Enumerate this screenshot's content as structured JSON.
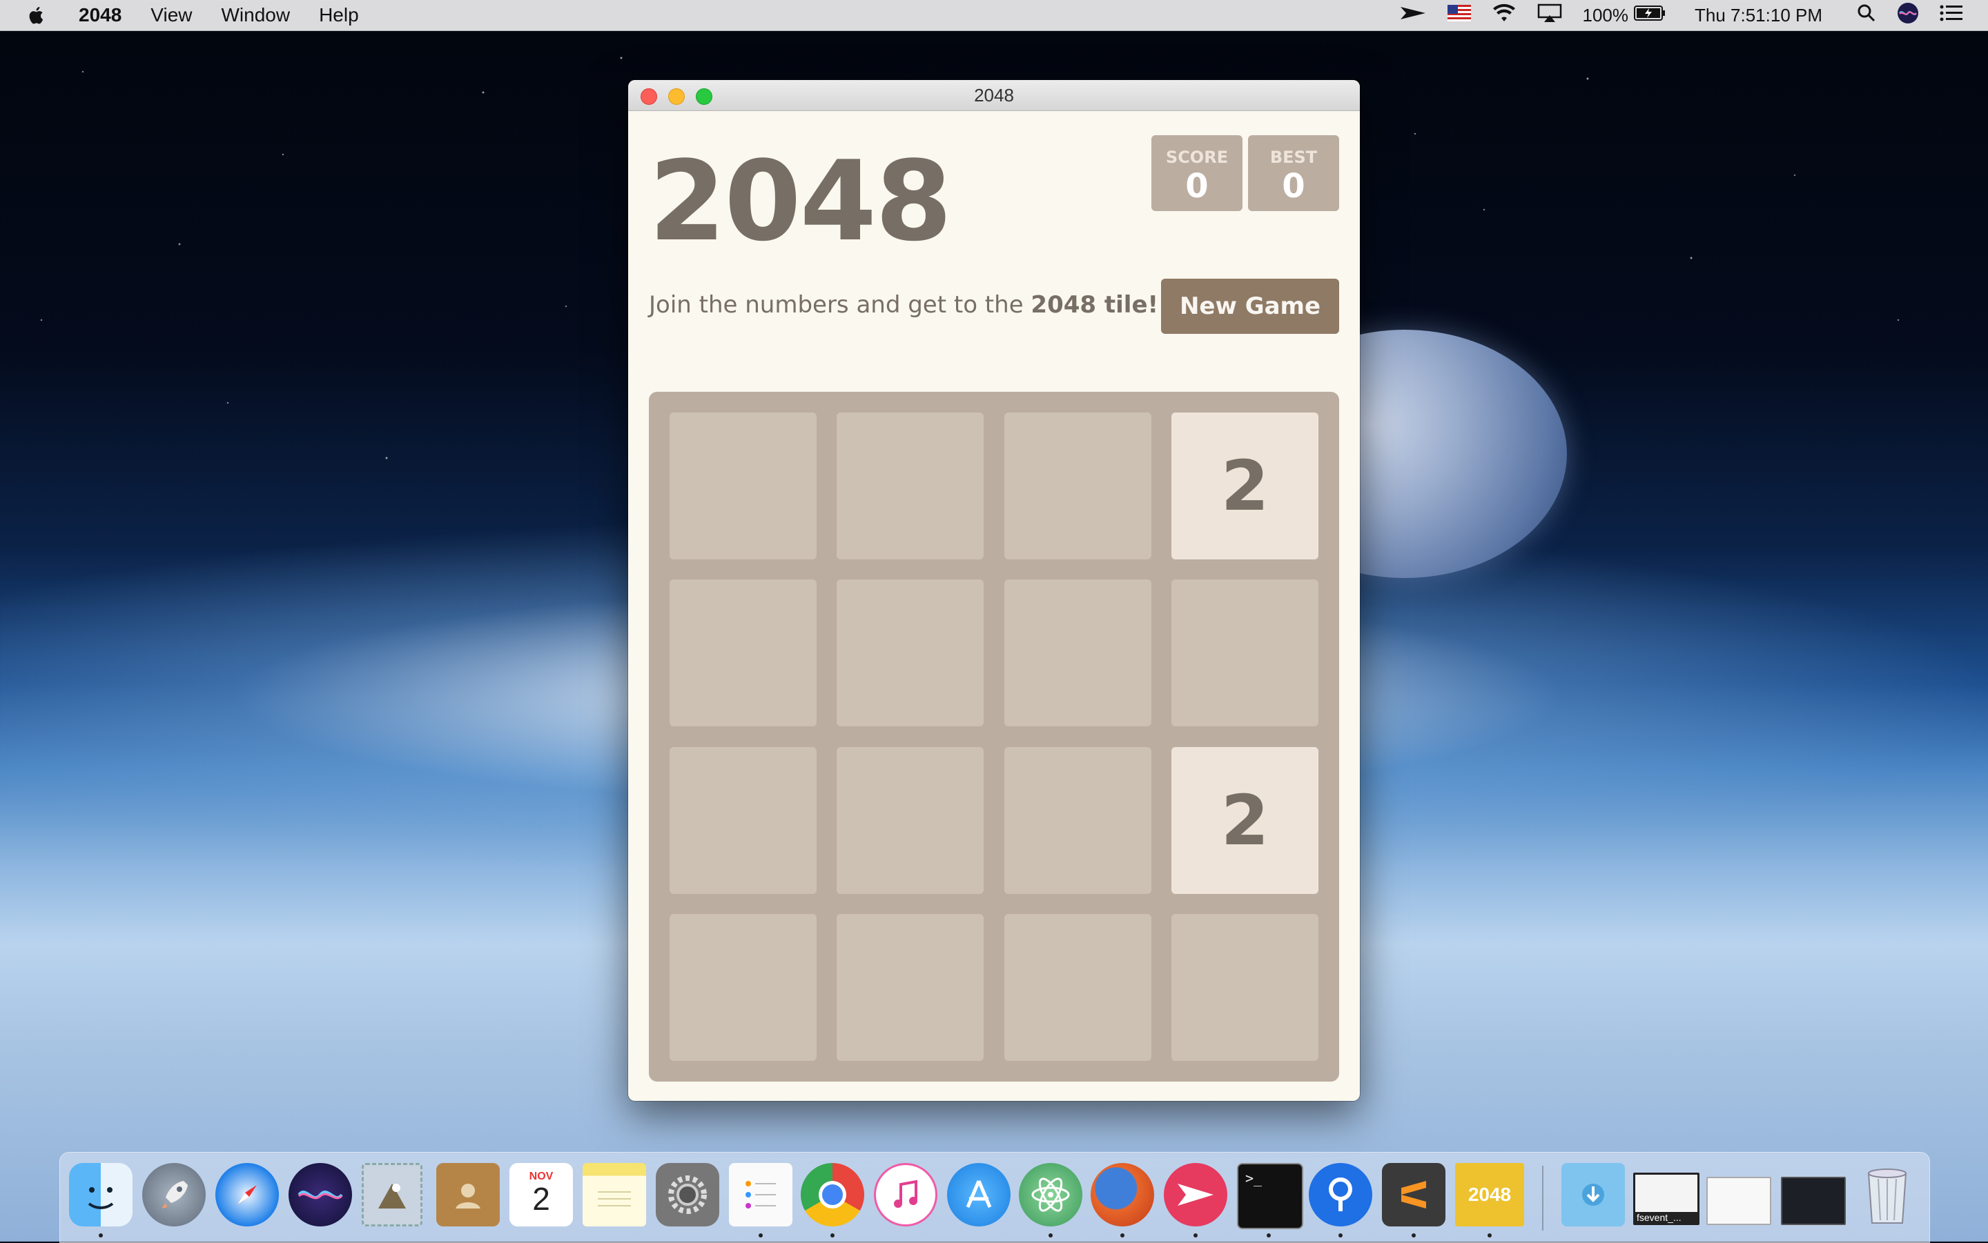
{
  "menubar": {
    "app_name": "2048",
    "menus": [
      "View",
      "Window",
      "Help"
    ],
    "battery": "100%",
    "clock": "Thu 7:51:10 PM"
  },
  "window": {
    "title": "2048"
  },
  "game": {
    "title": "2048",
    "score_label": "SCORE",
    "score_value": "0",
    "best_label": "BEST",
    "best_value": "0",
    "intro_prefix": "Join the numbers and get to the ",
    "intro_bold": "2048 tile!",
    "new_game_label": "New Game",
    "grid": [
      [
        "",
        "",
        "",
        "2"
      ],
      [
        "",
        "",
        "",
        ""
      ],
      [
        "",
        "",
        "",
        "2"
      ],
      [
        "",
        "",
        "",
        ""
      ]
    ]
  },
  "dock": {
    "items": [
      {
        "name": "finder",
        "icon": "finder-icon",
        "color": "#3d9bf0"
      },
      {
        "name": "launchpad",
        "icon": "rocket-icon",
        "color": "#7d8a99"
      },
      {
        "name": "safari",
        "icon": "compass-icon",
        "color": "#2e8cf0"
      },
      {
        "name": "siri",
        "icon": "siri-icon",
        "color": "#4a3a9a"
      },
      {
        "name": "mail-preview",
        "icon": "stamp-icon",
        "color": "#b8c6d6"
      },
      {
        "name": "contacts",
        "icon": "contacts-icon",
        "color": "#b58548"
      },
      {
        "name": "calendar",
        "icon": "calendar-icon",
        "color": "#ffffff"
      },
      {
        "name": "notes",
        "icon": "notes-icon",
        "color": "#f7e36f"
      },
      {
        "name": "system-preferences",
        "icon": "gear-icon",
        "color": "#7c7c7c"
      },
      {
        "name": "reminders",
        "icon": "list-icon",
        "color": "#fafafa"
      },
      {
        "name": "chrome",
        "icon": "chrome-icon",
        "color": "#e8453c"
      },
      {
        "name": "itunes",
        "icon": "music-note-icon",
        "color": "#f05aa6"
      },
      {
        "name": "app-store",
        "icon": "app-store-icon",
        "color": "#1e90ff"
      },
      {
        "name": "atom",
        "icon": "atom-icon",
        "color": "#5fb87a"
      },
      {
        "name": "firefox",
        "icon": "firefox-icon",
        "color": "#e8662a"
      },
      {
        "name": "airmail",
        "icon": "airmail-icon",
        "color": "#e63a5f"
      },
      {
        "name": "terminal",
        "icon": "terminal-icon",
        "color": "#111111"
      },
      {
        "name": "maps-pin",
        "icon": "pin-icon",
        "color": "#1f6fe5"
      },
      {
        "name": "sublime",
        "icon": "sublime-icon",
        "color": "#3a3a3a"
      },
      {
        "name": "2048-app",
        "icon": "2048-icon",
        "color": "#edc22e",
        "label": "2048"
      }
    ],
    "calendar_month": "NOV",
    "calendar_day": "2",
    "terminal_prompt": ">_",
    "stack_label": "fsevent_..."
  }
}
